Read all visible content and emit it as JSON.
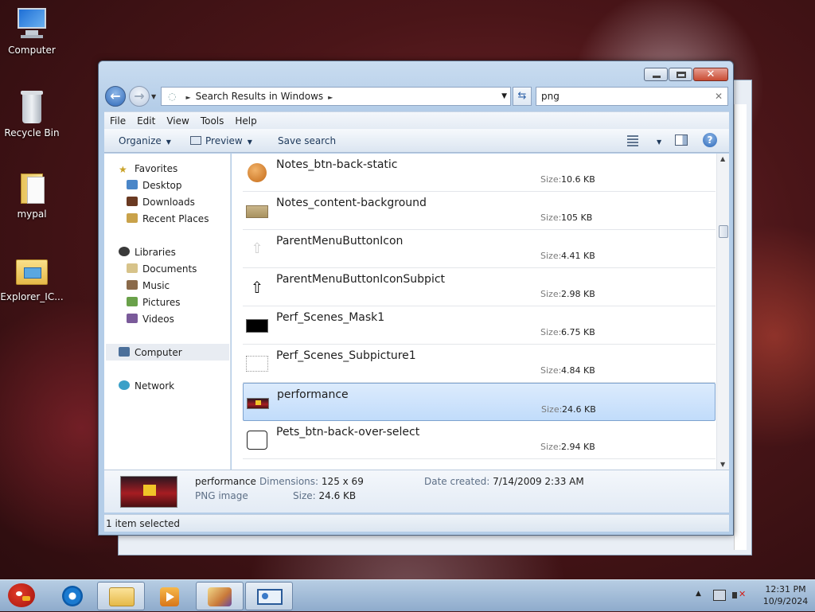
{
  "desktop": {
    "icons": [
      {
        "label": "Computer"
      },
      {
        "label": "Recycle Bin"
      },
      {
        "label": "mypal"
      },
      {
        "label": "Explorer_IC..."
      }
    ]
  },
  "window": {
    "address": {
      "crumb": "Search Results in Windows"
    },
    "search": {
      "value": "png",
      "clear_glyph": "✕"
    },
    "menu": [
      "File",
      "Edit",
      "View",
      "Tools",
      "Help"
    ],
    "toolbar": {
      "organize": "Organize",
      "preview": "Preview",
      "save_search": "Save search"
    },
    "nav": {
      "favorites": "Favorites",
      "desktop": "Desktop",
      "downloads": "Downloads",
      "recent_places": "Recent Places",
      "libraries": "Libraries",
      "documents": "Documents",
      "music": "Music",
      "pictures": "Pictures",
      "videos": "Videos",
      "computer": "Computer",
      "network": "Network"
    },
    "size_label": "Size:",
    "files": [
      {
        "name": "Notes_btn-back-static",
        "size": "10.6 KB",
        "thumb": "orange-circle-icon"
      },
      {
        "name": "Notes_content-background",
        "size": "105 KB",
        "thumb": "tan-panel-icon"
      },
      {
        "name": "ParentMenuButtonIcon",
        "size": "4.41 KB",
        "thumb": "light-up-arrow-icon"
      },
      {
        "name": "ParentMenuButtonIconSubpict",
        "size": "2.98 KB",
        "thumb": "outlined-up-arrow-icon"
      },
      {
        "name": "Perf_Scenes_Mask1",
        "size": "6.75 KB",
        "thumb": "black-rectangle-icon"
      },
      {
        "name": "Perf_Scenes_Subpicture1",
        "size": "4.84 KB",
        "thumb": "dotted-frame-icon"
      },
      {
        "name": "performance",
        "size": "24.6 KB",
        "thumb": "stage-image-thumbnail",
        "selected": true
      },
      {
        "name": "Pets_btn-back-over-select",
        "size": "2.94 KB",
        "thumb": "rounded-square-outline-icon"
      }
    ],
    "details": {
      "name": "performance",
      "type": "PNG image",
      "dimensions_label": "Dimensions:",
      "dimensions": "125 x 69",
      "size_label": "Size:",
      "size": "24.6 KB",
      "date_label": "Date created:",
      "date": "7/14/2009 2:33 AM"
    },
    "status": "1 item selected"
  },
  "taskbar": {
    "time": "12:31 PM",
    "date": "10/9/2024"
  },
  "colors": {
    "selection": "#c1dcfb",
    "selection_border": "#7da2ce",
    "window_frame": "#b4cde8"
  }
}
